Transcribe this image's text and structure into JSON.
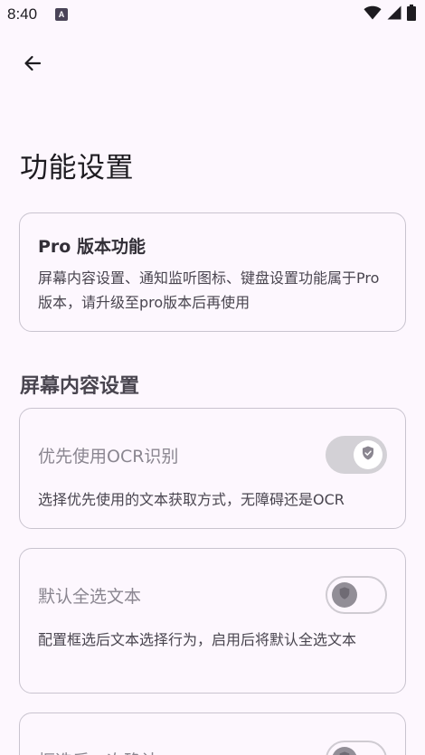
{
  "status_bar": {
    "time": "8:40",
    "notification_icon": "A",
    "icons": [
      "wifi-icon",
      "signal-icon",
      "battery-icon"
    ]
  },
  "app_bar": {
    "back_icon": "arrow-left-icon"
  },
  "page": {
    "title": "功能设置"
  },
  "pro_card": {
    "title": "Pro 版本功能",
    "description": "屏幕内容设置、通知监听图标、键盘设置功能属于Pro版本，请升级至pro版本后再使用"
  },
  "screen_content_section": {
    "title": "屏幕内容设置",
    "settings": [
      {
        "title": "优先使用OCR识别",
        "description": "选择优先使用的文本获取方式，无障碍还是OCR",
        "enabled": true,
        "disabled": true
      },
      {
        "title": "默认全选文本",
        "description": "配置框选后文本选择行为，启用后将默认全选文本",
        "enabled": false,
        "disabled": true
      },
      {
        "title": "框选后二次确认",
        "enabled": false,
        "disabled": true
      }
    ]
  },
  "colors": {
    "background": "#FDF7FE",
    "card_border": "#C9C4CF",
    "disabled_text": "#8A8690",
    "body_text": "#49454F"
  }
}
